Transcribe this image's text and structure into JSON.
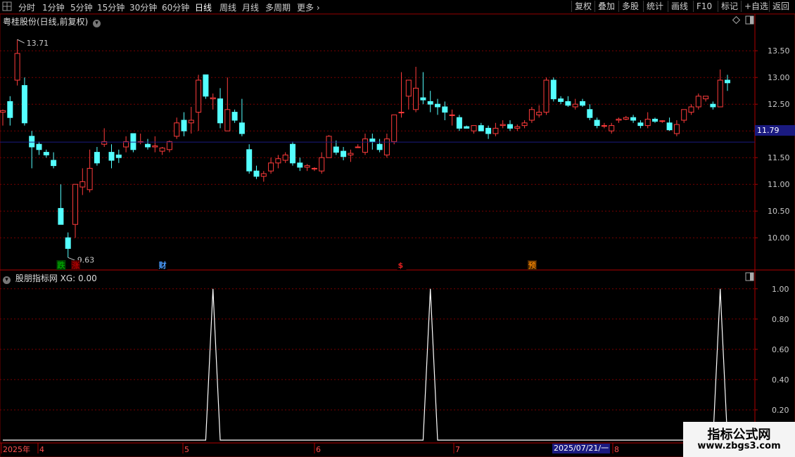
{
  "toolbar": {
    "periods": [
      "分时",
      "1分钟",
      "5分钟",
      "15分钟",
      "30分钟",
      "60分钟",
      "日线",
      "周线",
      "月线",
      "多周期",
      "更多"
    ],
    "active_period": "日线",
    "buttons": [
      "复权",
      "叠加",
      "多股",
      "统计",
      "画线",
      "F10",
      "标记",
      "+自选",
      "返回"
    ]
  },
  "stock": {
    "title": "粤桂股份(日线,前复权)",
    "high_label": "13.71",
    "low_label": "9.63",
    "current_price": "11.79"
  },
  "event_tags": [
    {
      "text": "跌",
      "color": "#00a000"
    },
    {
      "text": "涨",
      "color": "#b00000"
    },
    {
      "text": "财",
      "color": "#4a9cff"
    },
    {
      "text": "$",
      "color": "#e02020"
    },
    {
      "text": "预",
      "color": "#e07a00"
    }
  ],
  "indicator": {
    "title": "股朋指标网  XG: 0.00"
  },
  "date_axis": {
    "labels": [
      "2025年",
      "4",
      "5",
      "6",
      "7",
      "8"
    ],
    "highlight": "2025/07/21/一"
  },
  "watermark": {
    "line1": "指标公式网",
    "line2": "www.zbgs3.com"
  },
  "colors": {
    "up": "#ff3b3b",
    "down": "#54ffff",
    "grid": "#7a0000",
    "axis_text": "#c8c8c8",
    "signal_line": "#ffffff"
  },
  "chart_data": [
    {
      "type": "candlestick",
      "title": "粤桂股份(日线,前复权)",
      "ylim": [
        9.45,
        13.95
      ],
      "yticks": [
        10.0,
        10.5,
        11.0,
        11.5,
        12.0,
        12.5,
        13.0,
        13.5
      ],
      "annotations": {
        "max": 13.71,
        "min": 9.63,
        "last": 11.79
      },
      "ohlc": [
        [
          12.35,
          12.4,
          12.1,
          12.38
        ],
        [
          12.55,
          12.65,
          12.1,
          12.25
        ],
        [
          12.95,
          13.71,
          12.85,
          13.45
        ],
        [
          12.85,
          13.0,
          12.1,
          12.15
        ],
        [
          11.9,
          12.0,
          11.3,
          11.7
        ],
        [
          11.75,
          11.8,
          11.55,
          11.65
        ],
        [
          11.6,
          11.65,
          11.5,
          11.55
        ],
        [
          11.45,
          11.6,
          11.3,
          11.35
        ],
        [
          10.55,
          11.0,
          10.4,
          10.25
        ],
        [
          10.0,
          10.1,
          9.63,
          9.8
        ],
        [
          10.25,
          11.0,
          10.0,
          11.0
        ],
        [
          10.95,
          11.3,
          10.8,
          11.05
        ],
        [
          10.9,
          11.65,
          10.85,
          11.3
        ],
        [
          11.6,
          11.7,
          11.35,
          11.4
        ],
        [
          11.75,
          12.05,
          11.7,
          11.8
        ],
        [
          11.6,
          11.75,
          11.3,
          11.45
        ],
        [
          11.55,
          11.65,
          11.4,
          11.5
        ],
        [
          11.7,
          11.9,
          11.6,
          11.8
        ],
        [
          11.95,
          11.95,
          11.6,
          11.65
        ],
        [
          11.8,
          11.95,
          11.75,
          11.8
        ],
        [
          11.75,
          11.85,
          11.65,
          11.7
        ],
        [
          11.7,
          11.9,
          11.6,
          11.72
        ],
        [
          11.62,
          11.7,
          11.55,
          11.68
        ],
        [
          11.65,
          11.82,
          11.6,
          11.8
        ],
        [
          11.9,
          12.25,
          11.85,
          12.15
        ],
        [
          12.2,
          12.35,
          11.9,
          12.0
        ],
        [
          12.15,
          12.45,
          11.95,
          12.2
        ],
        [
          12.35,
          13.05,
          12.0,
          12.95
        ],
        [
          13.05,
          13.05,
          12.6,
          12.65
        ],
        [
          12.6,
          12.7,
          12.4,
          12.62
        ],
        [
          12.6,
          12.8,
          12.05,
          12.15
        ],
        [
          12.0,
          13.0,
          12.0,
          12.4
        ],
        [
          12.35,
          12.4,
          12.15,
          12.2
        ],
        [
          12.15,
          12.6,
          11.9,
          11.95
        ],
        [
          11.65,
          11.75,
          11.2,
          11.25
        ],
        [
          11.25,
          11.35,
          11.1,
          11.15
        ],
        [
          11.15,
          11.25,
          11.05,
          11.2
        ],
        [
          11.25,
          11.5,
          11.2,
          11.4
        ],
        [
          11.4,
          11.55,
          11.3,
          11.48
        ],
        [
          11.45,
          11.6,
          11.4,
          11.55
        ],
        [
          11.75,
          11.8,
          11.35,
          11.4
        ],
        [
          11.4,
          11.5,
          11.25,
          11.32
        ],
        [
          11.32,
          11.38,
          11.25,
          11.35
        ],
        [
          11.3,
          11.32,
          11.25,
          11.3
        ],
        [
          11.25,
          11.6,
          11.2,
          11.5
        ],
        [
          11.5,
          11.92,
          11.5,
          11.9
        ],
        [
          11.7,
          11.82,
          11.55,
          11.6
        ],
        [
          11.62,
          11.7,
          11.45,
          11.52
        ],
        [
          11.55,
          11.65,
          11.42,
          11.58
        ],
        [
          11.7,
          11.75,
          11.68,
          11.7
        ],
        [
          11.6,
          11.95,
          11.55,
          11.85
        ],
        [
          11.85,
          11.95,
          11.65,
          11.8
        ],
        [
          11.75,
          11.85,
          11.6,
          11.65
        ],
        [
          11.55,
          11.95,
          11.5,
          11.85
        ],
        [
          11.8,
          12.3,
          11.75,
          12.3
        ],
        [
          12.35,
          13.1,
          12.25,
          12.35
        ],
        [
          12.65,
          12.8,
          12.4,
          12.95
        ],
        [
          12.4,
          13.2,
          12.35,
          12.8
        ],
        [
          12.62,
          13.1,
          12.5,
          12.58
        ],
        [
          12.55,
          12.75,
          12.35,
          12.5
        ],
        [
          12.5,
          12.6,
          12.3,
          12.45
        ],
        [
          12.45,
          12.55,
          12.2,
          12.35
        ],
        [
          12.3,
          12.4,
          12.1,
          12.3
        ],
        [
          12.25,
          12.3,
          12.0,
          12.05
        ],
        [
          12.08,
          12.1,
          12.05,
          12.05
        ],
        [
          12.0,
          12.1,
          11.95,
          12.1
        ],
        [
          12.1,
          12.15,
          12.0,
          12.0
        ],
        [
          12.05,
          12.1,
          11.85,
          11.95
        ],
        [
          11.95,
          12.15,
          11.9,
          12.05
        ],
        [
          12.1,
          12.2,
          12.05,
          12.12
        ],
        [
          12.12,
          12.2,
          12.0,
          12.05
        ],
        [
          12.05,
          12.12,
          12.0,
          12.08
        ],
        [
          12.1,
          12.2,
          12.05,
          12.15
        ],
        [
          12.2,
          12.45,
          12.15,
          12.4
        ],
        [
          12.3,
          12.48,
          12.25,
          12.35
        ],
        [
          12.35,
          13.0,
          12.3,
          12.95
        ],
        [
          12.95,
          13.0,
          12.55,
          12.6
        ],
        [
          12.6,
          12.65,
          12.5,
          12.55
        ],
        [
          12.55,
          12.65,
          12.45,
          12.48
        ],
        [
          12.45,
          12.6,
          12.4,
          12.5
        ],
        [
          12.55,
          12.6,
          12.45,
          12.48
        ],
        [
          12.4,
          12.5,
          12.2,
          12.25
        ],
        [
          12.2,
          12.25,
          12.05,
          12.1
        ],
        [
          12.1,
          12.15,
          12.05,
          12.1
        ],
        [
          12.0,
          12.15,
          11.95,
          12.1
        ],
        [
          12.2,
          12.25,
          12.15,
          12.22
        ],
        [
          12.22,
          12.28,
          12.2,
          12.25
        ],
        [
          12.25,
          12.3,
          12.15,
          12.2
        ],
        [
          12.15,
          12.2,
          12.05,
          12.1
        ],
        [
          12.1,
          12.35,
          12.05,
          12.22
        ],
        [
          12.22,
          12.25,
          12.15,
          12.18
        ],
        [
          12.18,
          12.2,
          12.15,
          12.19
        ],
        [
          12.15,
          12.25,
          12.0,
          12.02
        ],
        [
          11.95,
          12.2,
          11.9,
          12.12
        ],
        [
          12.2,
          12.4,
          12.15,
          12.4
        ],
        [
          12.35,
          12.5,
          12.3,
          12.45
        ],
        [
          12.45,
          12.7,
          12.4,
          12.65
        ],
        [
          12.6,
          12.65,
          12.55,
          12.65
        ],
        [
          12.5,
          12.55,
          12.4,
          12.45
        ],
        [
          12.45,
          13.15,
          12.45,
          12.95
        ],
        [
          12.95,
          13.05,
          12.75,
          12.9
        ]
      ]
    },
    {
      "type": "line",
      "title": "股朋指标网  XG: 0.00",
      "ylim": [
        0,
        1.05
      ],
      "yticks": [
        0.2,
        0.4,
        0.6,
        0.8,
        1.0
      ],
      "series": [
        {
          "name": "XG",
          "values": [
            0,
            0,
            0,
            0,
            0,
            0,
            0,
            0,
            0,
            0,
            0,
            0,
            0,
            0,
            0,
            0,
            0,
            0,
            0,
            0,
            0,
            0,
            0,
            0,
            0,
            0,
            0,
            0,
            0,
            1,
            0,
            0,
            0,
            0,
            0,
            0,
            0,
            0,
            0,
            0,
            0,
            0,
            0,
            0,
            0,
            0,
            0,
            0,
            0,
            0,
            0,
            0,
            0,
            0,
            0,
            0,
            0,
            0,
            0,
            1,
            0,
            0,
            0,
            0,
            0,
            0,
            0,
            0,
            0,
            0,
            0,
            0,
            0,
            0,
            0,
            0,
            0,
            0,
            0,
            0,
            0,
            0,
            0,
            0,
            0,
            0,
            0,
            0,
            0,
            0,
            0,
            0,
            0,
            0,
            0,
            0,
            0,
            0,
            0,
            1,
            0
          ]
        }
      ]
    }
  ]
}
